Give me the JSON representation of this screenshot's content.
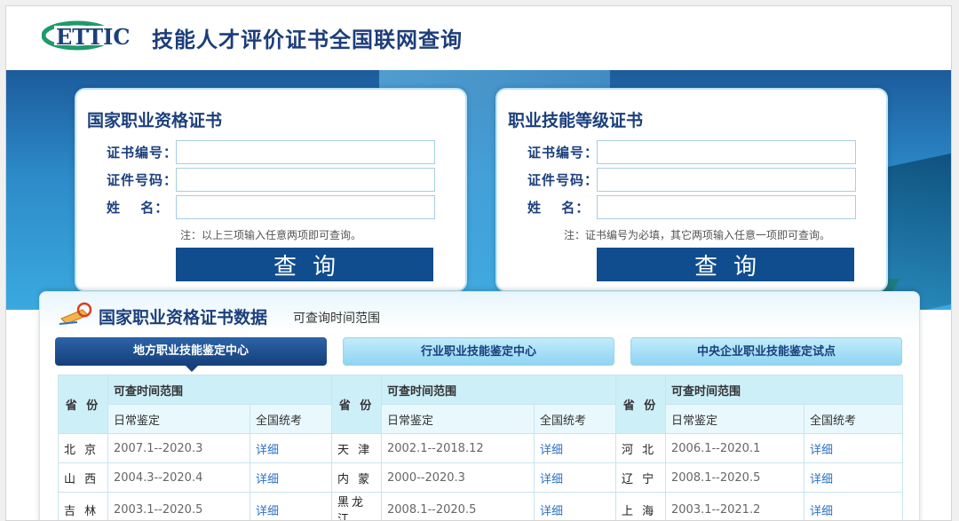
{
  "header": {
    "logo_text": "ETTIC",
    "title": "技能人才评价证书全国联网查询"
  },
  "card_left": {
    "title": "国家职业资格证书",
    "fields": [
      {
        "label": "证书编号：",
        "value": "",
        "placeholder": ""
      },
      {
        "label": "证件号码：",
        "value": "",
        "placeholder": ""
      },
      {
        "label": "姓　 名：",
        "value": "",
        "placeholder": ""
      }
    ],
    "note": "注：以上三项输入任意两项即可查询。",
    "button": "查询"
  },
  "card_right": {
    "title": "职业技能等级证书",
    "fields": [
      {
        "label": "证书编号：",
        "value": "",
        "placeholder": ""
      },
      {
        "label": "证件号码：",
        "value": "",
        "placeholder": ""
      },
      {
        "label": "姓　 名：",
        "value": "",
        "placeholder": ""
      }
    ],
    "note": "注：证书编号为必填，其它两项输入任意一项即可查询。",
    "button": "查询"
  },
  "panel": {
    "title": "国家职业资格证书数据",
    "subtitle": "可查询时间范围",
    "tabs": [
      {
        "label": "地方职业技能鉴定中心",
        "active": true
      },
      {
        "label": "行业职业技能鉴定中心",
        "active": false
      },
      {
        "label": "中央企业职业技能鉴定试点",
        "active": false
      }
    ],
    "table": {
      "col_province": "省 份",
      "col_range": "可查时间范围",
      "col_daily": "日常鉴定",
      "col_national": "全国统考",
      "rows": [
        [
          {
            "province": "北 京",
            "range": "2007.1--2020.3",
            "link": "详细"
          },
          {
            "province": "天 津",
            "range": "2002.1--2018.12",
            "link": "详细"
          },
          {
            "province": "河 北",
            "range": "2006.1--2020.1",
            "link": "详细"
          }
        ],
        [
          {
            "province": "山 西",
            "range": "2004.3--2020.4",
            "link": "详细"
          },
          {
            "province": "内 蒙",
            "range": "2000--2020.3",
            "link": "详细"
          },
          {
            "province": "辽 宁",
            "range": "2008.1--2020.5",
            "link": "详细"
          }
        ],
        [
          {
            "province": "吉 林",
            "range": "2003.1--2020.5",
            "link": "详细"
          },
          {
            "province": "黑龙江",
            "range": "2008.1--2020.5",
            "link": "详细"
          },
          {
            "province": "上 海",
            "range": "2003.1--2021.2",
            "link": "详细"
          }
        ]
      ]
    }
  },
  "colors": {
    "brand_navy": "#1b3f7c",
    "button_blue": "#0f4d8f",
    "link_blue": "#2a72c8",
    "logo_green": "#1f9a6b"
  }
}
